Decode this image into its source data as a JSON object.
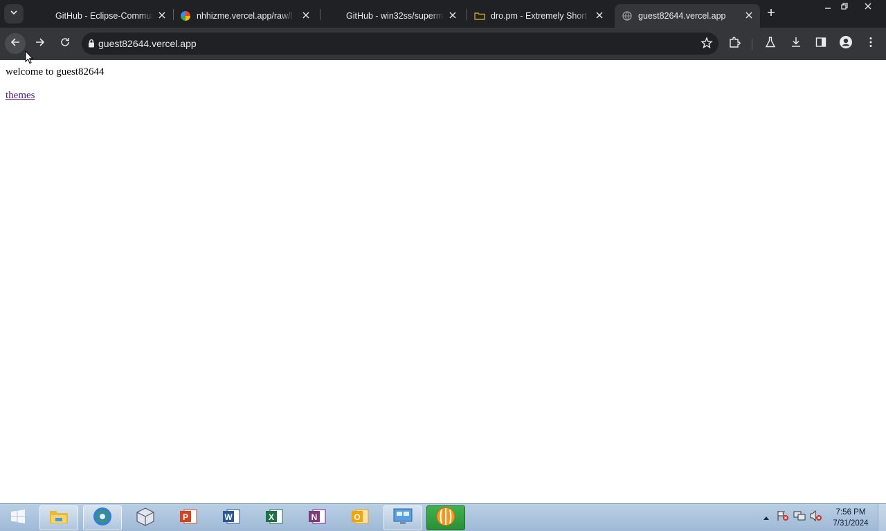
{
  "browser": {
    "tabs": [
      {
        "title": "GitHub - Eclipse-Commun",
        "favicon": "github-icon"
      },
      {
        "title": "nhhizme.vercel.app/raw/l",
        "favicon": "colorful-pinwheel-icon"
      },
      {
        "title": "GitHub - win32ss/superm",
        "favicon": "github-icon"
      },
      {
        "title": "dro.pm - Extremely Short",
        "favicon": "folder-icon"
      },
      {
        "title": "guest82644.vercel.app",
        "favicon": "globe-icon"
      }
    ],
    "active_tab_index": 4,
    "address": "guest82644.vercel.app"
  },
  "page": {
    "welcome_text": "welcome to guest82644",
    "link_text": "themes"
  },
  "taskbar": {
    "apps": [
      "file-explorer",
      "chrome",
      "virtualbox",
      "powerpoint",
      "word",
      "excel",
      "onenote",
      "outlook",
      "remote-desktop",
      "media-player"
    ],
    "clock_time": "7:56 PM",
    "clock_date": "7/31/2024"
  },
  "colors": {
    "chrome_dark": "#202124",
    "toolbar": "#35363a",
    "link_visited": "#551a8b"
  }
}
